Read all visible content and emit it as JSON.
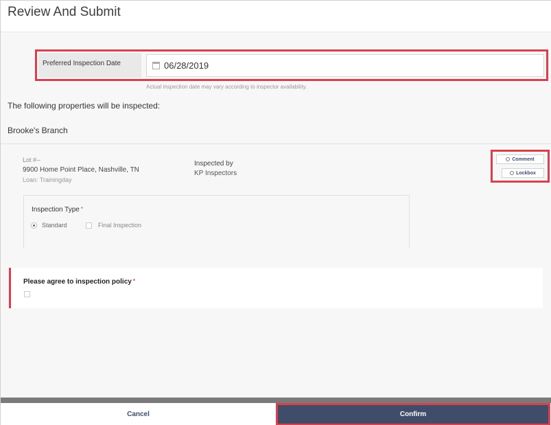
{
  "header": {
    "title": "Review And Submit"
  },
  "preferred_date": {
    "label": "Preferred Inspection Date",
    "value": "06/28/2019",
    "note": "Actual inspection date may vary according to inspector availability."
  },
  "properties_heading": "The following properties will be inspected:",
  "branch": "Brooke's Branch",
  "property": {
    "lot": "Lot #--",
    "address": "9900 Home Point Place, Nashville, TN",
    "loan": "Loan: Trainingday",
    "inspected_by_label": "Inspected by",
    "inspector": "KP Inspectors"
  },
  "actions": {
    "comment": "Comment",
    "lockbox": "Lockbox"
  },
  "inspection_type": {
    "label": "Inspection Type",
    "required_mark": "*",
    "options": [
      "Standard",
      "Final Inspection"
    ],
    "selected": "Standard"
  },
  "policy": {
    "label": "Please agree to inspection policy",
    "required_mark": "*"
  },
  "footer": {
    "cancel": "Cancel",
    "confirm": "Confirm"
  },
  "colors": {
    "accent": "#3f4d6b",
    "highlight": "#d9404c"
  }
}
